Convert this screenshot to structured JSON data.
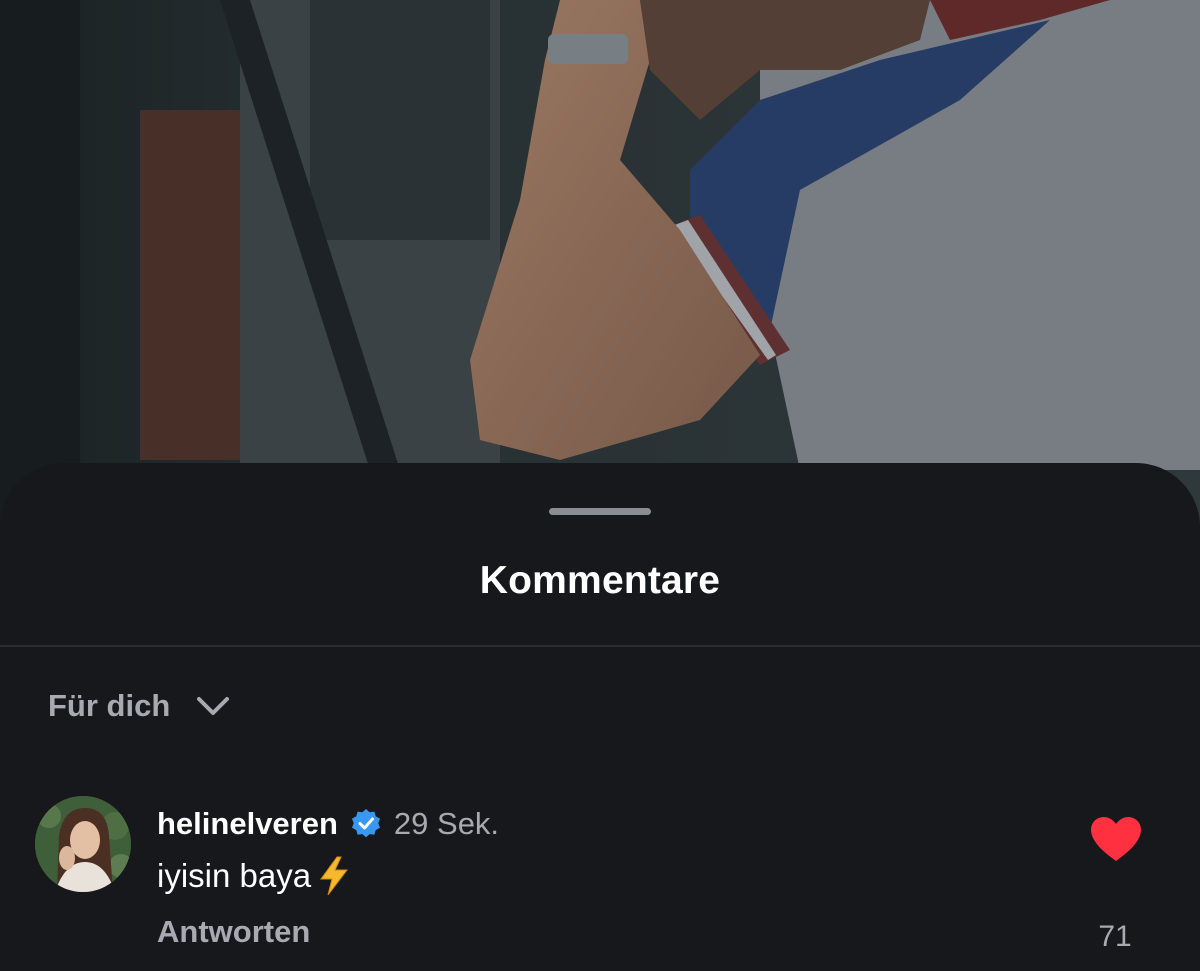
{
  "sheet": {
    "title": "Kommentare"
  },
  "filter": {
    "label": "Für dich",
    "icon": "chevron-down-icon"
  },
  "comment": {
    "username": "helinelveren",
    "verified": true,
    "timestamp": "29 Sek.",
    "text": "iyisin baya",
    "emoji": "lightning-bolt-icon",
    "reply_label": "Antworten",
    "like_count": "71",
    "liked": true
  },
  "colors": {
    "sheet_background": "#16181c",
    "primary_text": "#ffffff",
    "secondary_text": "#a7abb1",
    "verified_blue": "#3897f0",
    "like_red": "#ff3040"
  }
}
